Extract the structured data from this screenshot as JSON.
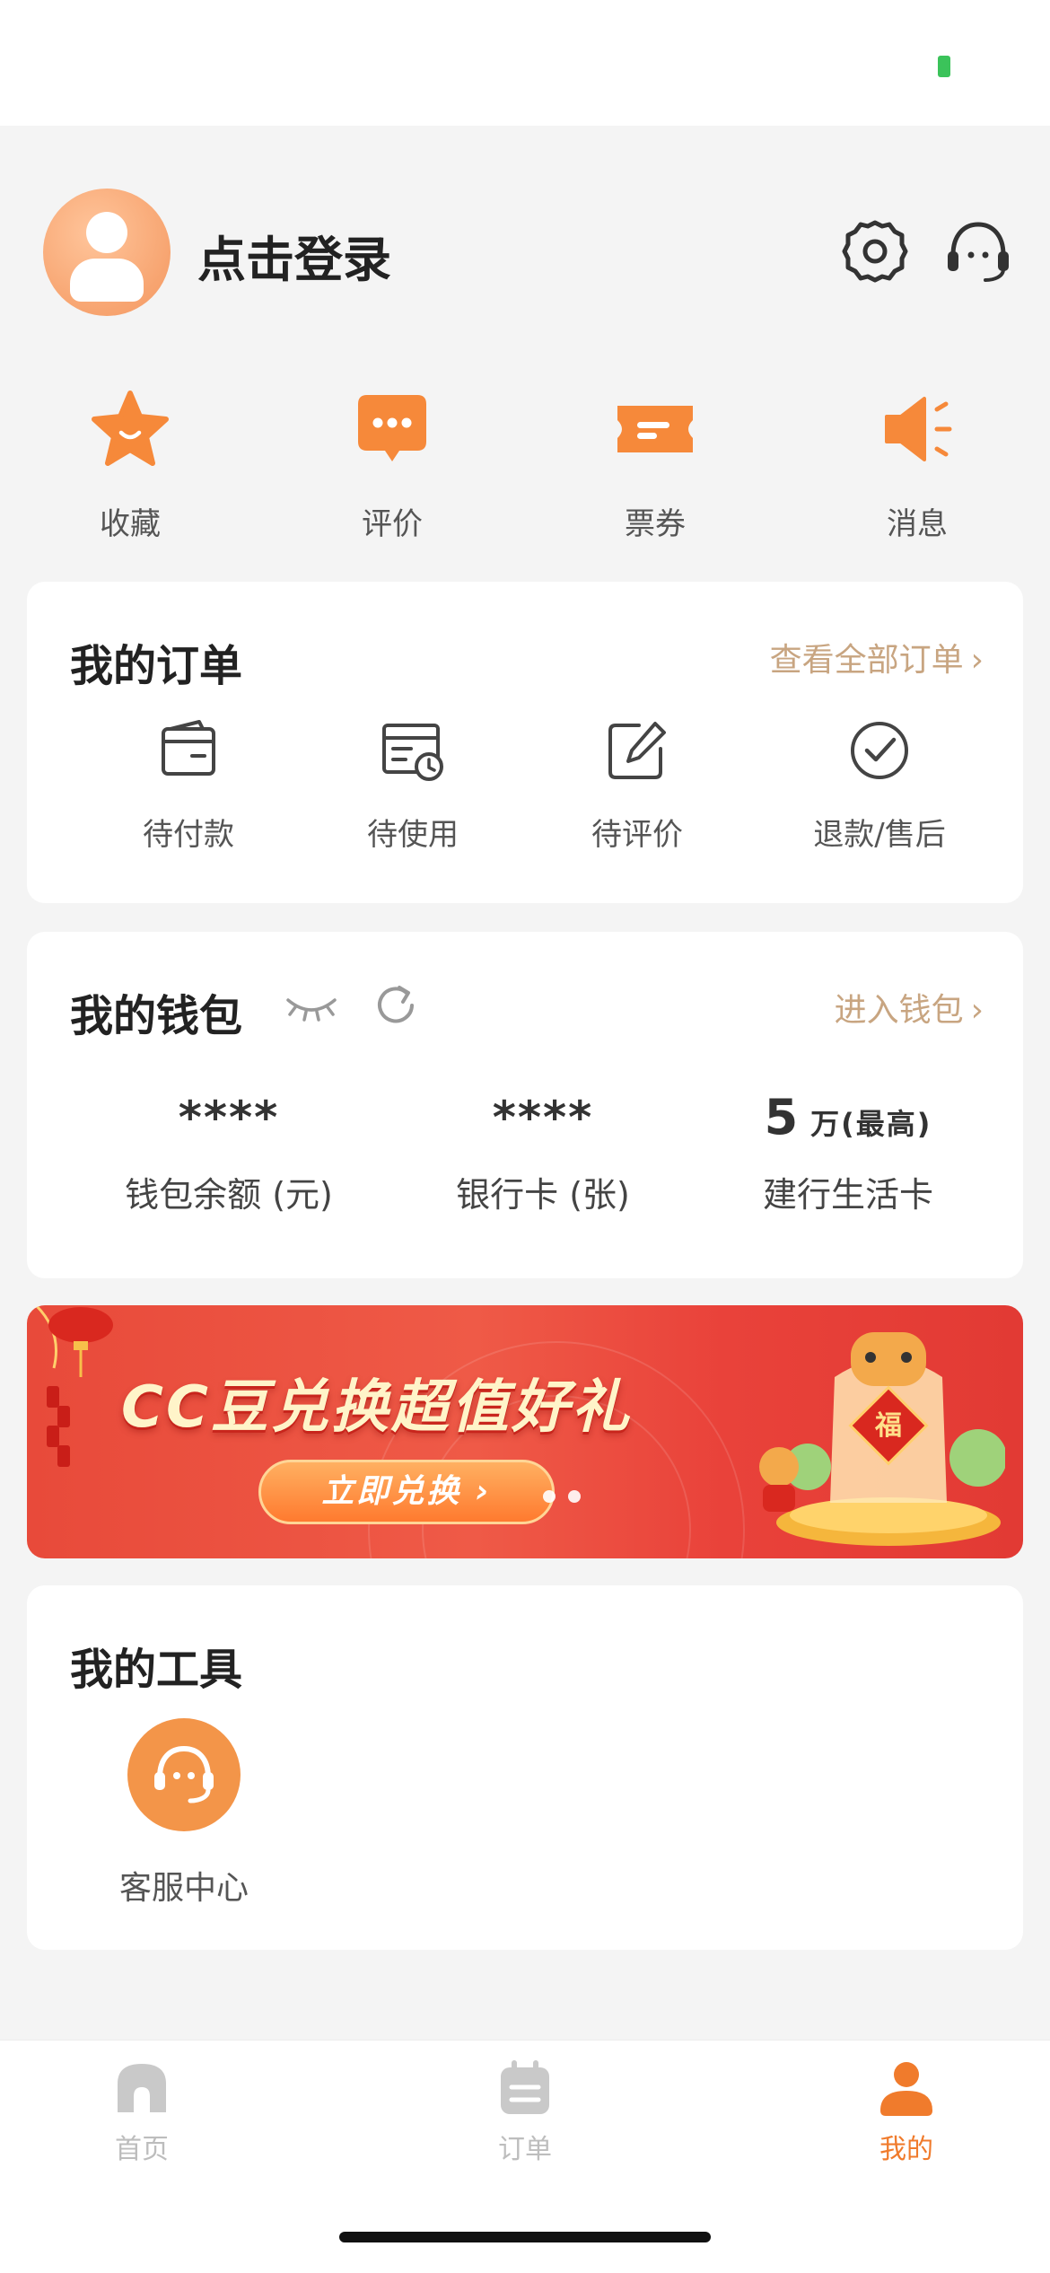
{
  "header": {
    "login_text": "点击登录"
  },
  "quick_entries": [
    {
      "label": "收藏",
      "icon": "star-icon"
    },
    {
      "label": "评价",
      "icon": "chat-bubble-icon"
    },
    {
      "label": "票券",
      "icon": "ticket-icon"
    },
    {
      "label": "消息",
      "icon": "megaphone-icon"
    }
  ],
  "orders": {
    "title": "我的订单",
    "view_all": "查看全部订单",
    "items": [
      {
        "label": "待付款",
        "icon": "wallet-icon"
      },
      {
        "label": "待使用",
        "icon": "calendar-clock-icon"
      },
      {
        "label": "待评价",
        "icon": "edit-icon"
      },
      {
        "label": "退款/售后",
        "icon": "check-circle-icon"
      }
    ]
  },
  "wallet": {
    "title": "我的钱包",
    "enter": "进入钱包",
    "items": [
      {
        "value": "****",
        "label": "钱包余额 (元)"
      },
      {
        "value": "****",
        "label": "银行卡 (张)"
      },
      {
        "value": "5",
        "value_suffix": "万(最高)",
        "label": "建行生活卡"
      }
    ]
  },
  "banner": {
    "title": "CC豆兑换超值好礼",
    "button": "立即兑换 ›",
    "badge": "福"
  },
  "tools": {
    "title": "我的工具",
    "items": [
      {
        "label": "客服中心",
        "icon": "headset-icon"
      }
    ]
  },
  "tabbar": {
    "tabs": [
      {
        "label": "首页",
        "active": false
      },
      {
        "label": "订单",
        "active": false
      },
      {
        "label": "我的",
        "active": true
      }
    ]
  },
  "colors": {
    "accent": "#f07b2c",
    "link": "#c8a581",
    "background": "#f4f4f4"
  }
}
